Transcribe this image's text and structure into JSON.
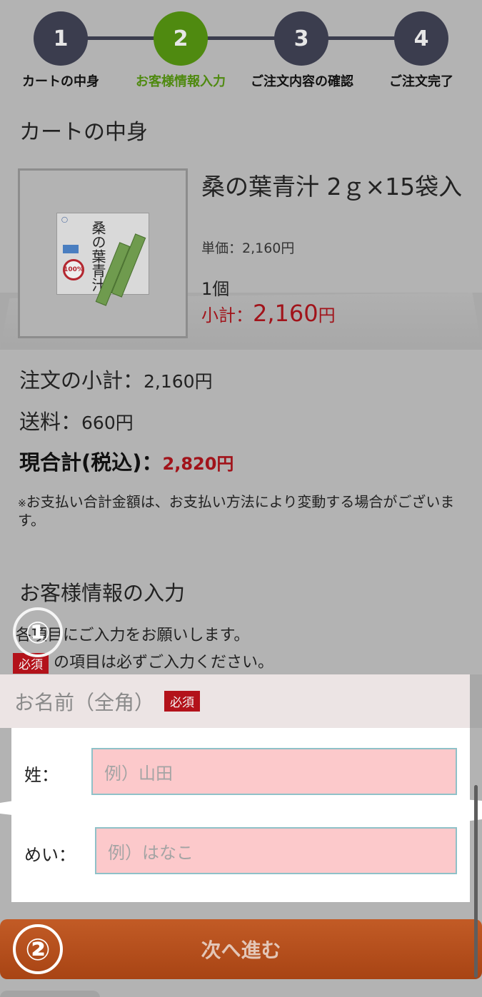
{
  "steps": [
    {
      "num": "1",
      "label": "カートの中身"
    },
    {
      "num": "2",
      "label": "お客様情報入力"
    },
    {
      "num": "3",
      "label": "ご注文内容の確認"
    },
    {
      "num": "4",
      "label": "ご注文完了"
    }
  ],
  "cart": {
    "title": "カートの中身",
    "item": {
      "name": "桑の葉青汁 2ｇ×15袋入",
      "unit_price": "単価：2,160円",
      "quantity": "1個",
      "subtotal_label": "小計：",
      "subtotal_amount": "2,160",
      "subtotal_unit": "円",
      "package_name": "桑の葉青汁",
      "package_badge": "100%"
    }
  },
  "summary": {
    "order_subtotal_label": "注文の小計：",
    "order_subtotal_value": "2,160円",
    "shipping_label": "送料：",
    "shipping_value": "660円",
    "total_label": "現合計(税込)：",
    "total_value": "2,820円",
    "note_mark": "※",
    "note": "お支払い合計金額は、お支払い方法により変動する場合がございます。"
  },
  "customer": {
    "title": "お客様情報の入力",
    "intro": "各項目にご入力をお願いします。",
    "required_badge": "必須",
    "required_note": " の項目は必ずご入力ください。",
    "name_section_label": "お名前（全角）",
    "last_name_label": "姓：",
    "last_name_placeholder": "例）山田",
    "first_name_label": "めい：",
    "first_name_placeholder": "例）はなこ"
  },
  "next_button": "次へ進む",
  "annotations": {
    "one": "①",
    "two": "②"
  },
  "colors": {
    "stepper_active": "#4f8a10",
    "stepper_inactive": "#3b3d4e",
    "price_red": "#a1131a",
    "required_red": "#b3121a",
    "button_orange": "#b34e1c",
    "input_pink": "#fcc9cb"
  }
}
